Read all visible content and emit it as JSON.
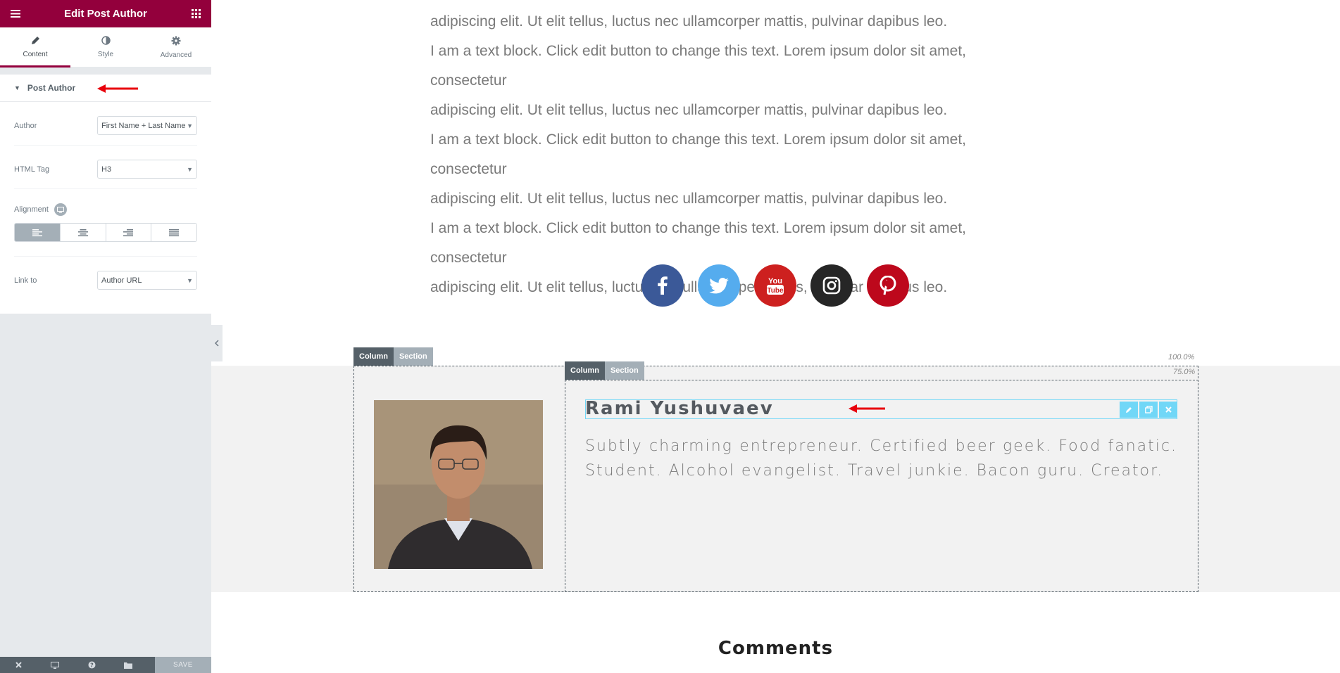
{
  "panel": {
    "title": "Edit Post Author",
    "tabs": [
      {
        "label": "Content",
        "icon": "pencil-icon",
        "active": true
      },
      {
        "label": "Style",
        "icon": "half-circle-icon",
        "active": false
      },
      {
        "label": "Advanced",
        "icon": "gear-icon",
        "active": false
      }
    ],
    "section_title": "Post Author",
    "controls": {
      "author": {
        "label": "Author",
        "value": "First Name + Last Name"
      },
      "html_tag": {
        "label": "HTML Tag",
        "value": "H3"
      },
      "alignment": {
        "label": "Alignment",
        "active": "left"
      },
      "link_to": {
        "label": "Link to",
        "value": "Author URL"
      }
    },
    "footer": {
      "save_label": "SAVE"
    }
  },
  "canvas": {
    "text_lines": [
      "adipiscing elit. Ut elit tellus, luctus nec ullamcorper mattis, pulvinar dapibus leo.",
      "I am a text block. Click edit button to change this text. Lorem ipsum dolor sit amet, consectetur",
      "adipiscing elit. Ut elit tellus, luctus nec ullamcorper mattis, pulvinar dapibus leo.",
      "I am a text block. Click edit button to change this text. Lorem ipsum dolor sit amet, consectetur",
      "adipiscing elit. Ut elit tellus, luctus nec ullamcorper mattis, pulvinar dapibus leo.",
      "I am a text block. Click edit button to change this text. Lorem ipsum dolor sit amet, consectetur",
      "adipiscing elit. Ut elit tellus, luctus nec ullamcorper mattis, pulvinar dapibus leo."
    ],
    "social": [
      {
        "name": "facebook",
        "color": "#3b5998"
      },
      {
        "name": "twitter",
        "color": "#55acee"
      },
      {
        "name": "youtube",
        "color": "#cd201f"
      },
      {
        "name": "instagram",
        "color": "#262626"
      },
      {
        "name": "pinterest",
        "color": "#bd081c"
      }
    ],
    "edit_handles": {
      "column": "Column",
      "section": "Section"
    },
    "widths": {
      "outer": "100.0%",
      "inner": "75.0%"
    },
    "author_name": "Rami Yushuvaev",
    "author_bio": "Subtly charming entrepreneur. Certified beer geek. Food fanatic. Student. Alcohol evangelist. Travel junkie. Bacon guru. Creator.",
    "comments_title": "Comments"
  },
  "colors": {
    "brand": "#93003c",
    "handle": "#71d7f7",
    "arrow": "#e8000b"
  }
}
